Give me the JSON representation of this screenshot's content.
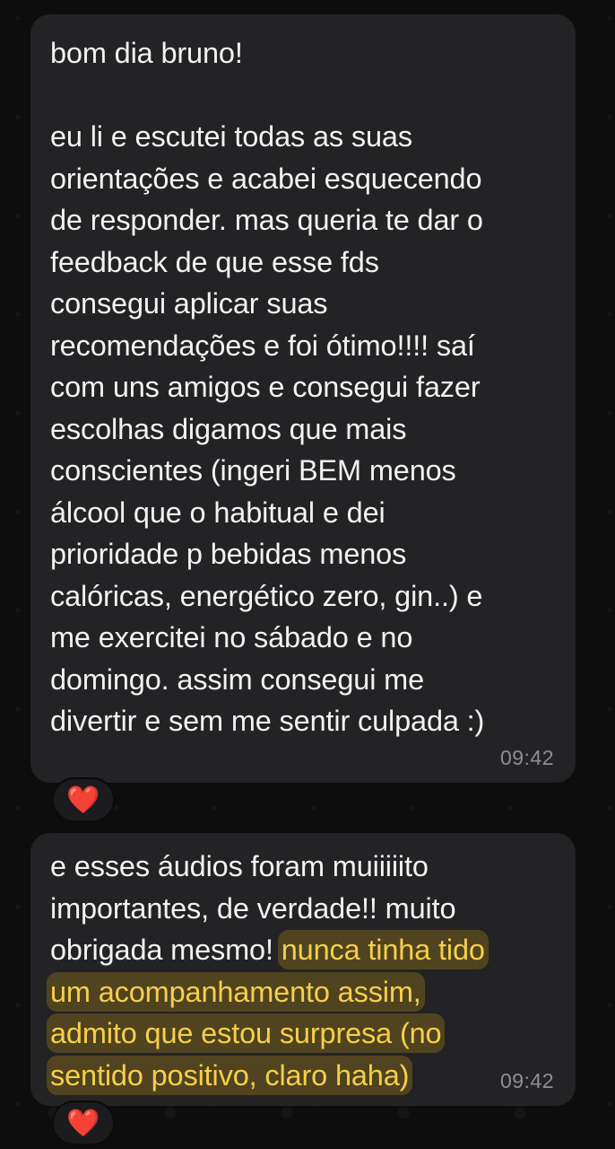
{
  "messages": [
    {
      "lines": [
        {
          "parts": [
            {
              "text": "bom dia bruno!",
              "highlight": false
            }
          ]
        },
        {
          "parts": [
            {
              "text": "",
              "highlight": false
            }
          ]
        },
        {
          "parts": [
            {
              "text": "eu li e escutei todas as suas",
              "highlight": false
            }
          ]
        },
        {
          "parts": [
            {
              "text": "orientações e acabei esquecendo",
              "highlight": false
            }
          ]
        },
        {
          "parts": [
            {
              "text": "de responder. mas queria te dar o",
              "highlight": false
            }
          ]
        },
        {
          "parts": [
            {
              "text": "feedback de que esse fds",
              "highlight": false
            }
          ]
        },
        {
          "parts": [
            {
              "text": "consegui aplicar suas",
              "highlight": false
            }
          ]
        },
        {
          "parts": [
            {
              "text": "recomendações e foi ótimo!!!! saí",
              "highlight": false
            }
          ]
        },
        {
          "parts": [
            {
              "text": "com uns amigos e consegui fazer",
              "highlight": false
            }
          ]
        },
        {
          "parts": [
            {
              "text": "escolhas digamos que mais",
              "highlight": false
            }
          ]
        },
        {
          "parts": [
            {
              "text": "conscientes (ingeri BEM menos",
              "highlight": false
            }
          ]
        },
        {
          "parts": [
            {
              "text": "álcool que o habitual e dei",
              "highlight": false
            }
          ]
        },
        {
          "parts": [
            {
              "text": "prioridade p bebidas menos",
              "highlight": false
            }
          ]
        },
        {
          "parts": [
            {
              "text": "calóricas, energético zero, gin..) e",
              "highlight": false
            }
          ]
        },
        {
          "parts": [
            {
              "text": "me exercitei no sábado e no",
              "highlight": false
            }
          ]
        },
        {
          "parts": [
            {
              "text": "domingo. assim consegui me",
              "highlight": false
            }
          ]
        },
        {
          "parts": [
            {
              "text": "divertir e sem me sentir culpada :)",
              "highlight": false
            }
          ]
        }
      ],
      "time": "09:42",
      "reaction": "❤️"
    },
    {
      "lines": [
        {
          "parts": [
            {
              "text": "e esses áudios foram muiiiiito",
              "highlight": false
            }
          ]
        },
        {
          "parts": [
            {
              "text": "importantes, de verdade!! muito",
              "highlight": false
            }
          ]
        },
        {
          "parts": [
            {
              "text": "obrigada mesmo! ",
              "highlight": false
            },
            {
              "text": "nunca tinha tido",
              "highlight": true
            }
          ]
        },
        {
          "parts": [
            {
              "text": "um acompanhamento assim,",
              "highlight": true
            }
          ]
        },
        {
          "parts": [
            {
              "text": "admito que estou surpresa (no",
              "highlight": true
            }
          ]
        },
        {
          "parts": [
            {
              "text": "sentido positivo, claro haha)",
              "highlight": true
            }
          ]
        }
      ],
      "time": "09:42",
      "reaction": "❤️"
    }
  ],
  "colors": {
    "bubble": "#232325",
    "text": "#f2f2f2",
    "highlight_text": "#f6cf4a",
    "time": "#8e8e93",
    "background": "#0b0b0b"
  }
}
